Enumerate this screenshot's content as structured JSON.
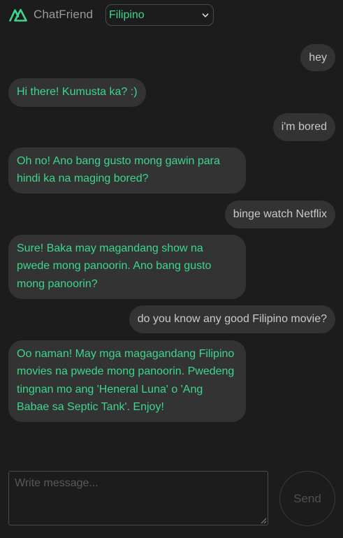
{
  "header": {
    "app_name": "ChatFriend",
    "language": {
      "selected": "Filipino"
    }
  },
  "colors": {
    "accent": "#3dd68c",
    "background": "#1c1c1c",
    "bubble": "#333333",
    "user_text": "#c9c9c9"
  },
  "messages": [
    {
      "sender": "user",
      "text": "hey"
    },
    {
      "sender": "bot",
      "text": "Hi there! Kumusta ka? :)"
    },
    {
      "sender": "user",
      "text": "i'm bored"
    },
    {
      "sender": "bot",
      "text": "Oh no! Ano bang gusto mong gawin para hindi ka na maging bored?"
    },
    {
      "sender": "user",
      "text": "binge watch Netflix"
    },
    {
      "sender": "bot",
      "text": "Sure! Baka may magandang show na pwede mong panoorin. Ano bang gusto mong panoorin?"
    },
    {
      "sender": "user",
      "text": "do you know any good Filipino movie?"
    },
    {
      "sender": "bot",
      "text": "Oo naman! May mga magagandang Filipino movies na pwede mong panoorin. Pwedeng tingnan mo ang 'Heneral Luna' o 'Ang Babae sa Septic Tank'. Enjoy!"
    }
  ],
  "composer": {
    "placeholder": "Write message...",
    "value": "",
    "send_label": "Send"
  }
}
